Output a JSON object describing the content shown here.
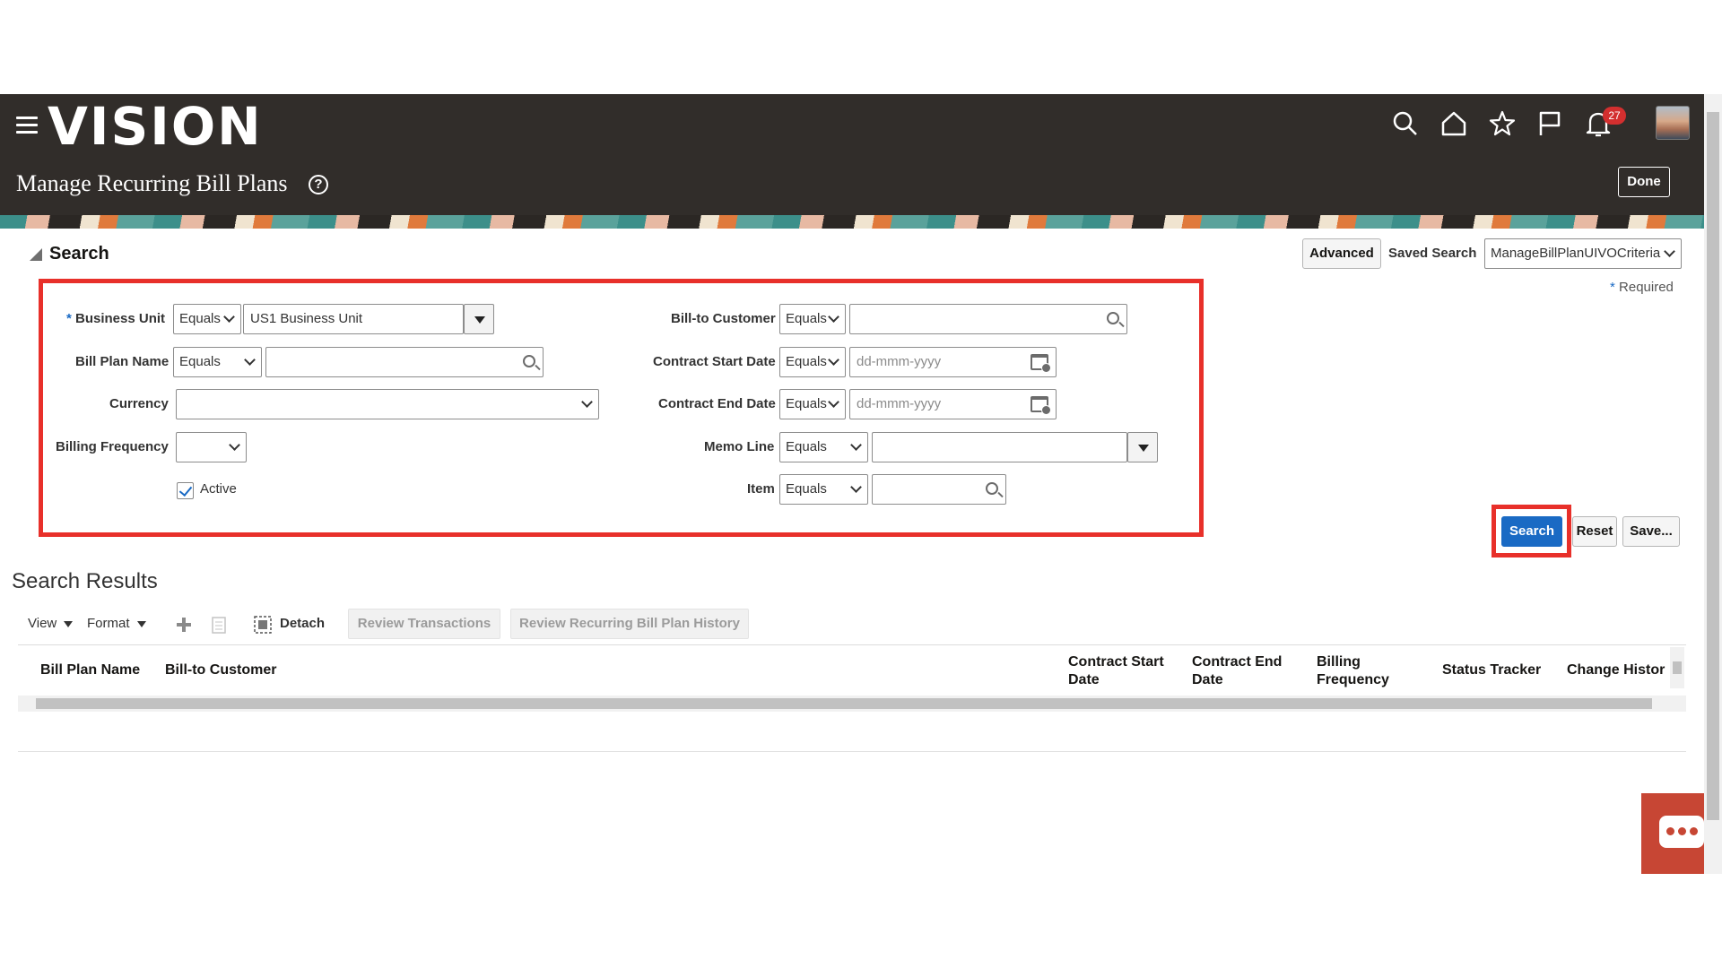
{
  "header": {
    "logo": "VISION",
    "page_title": "Manage Recurring Bill Plans",
    "notification_count": "27",
    "done_label": "Done"
  },
  "search": {
    "title": "Search",
    "advanced_label": "Advanced",
    "saved_search_label": "Saved Search",
    "saved_search_value": "ManageBillPlanUIVOCriteria",
    "required_label": "Required",
    "fields": {
      "business_unit": {
        "label": "Business Unit",
        "operator": "Equals",
        "value": "US1 Business Unit"
      },
      "bill_plan_name": {
        "label": "Bill Plan Name",
        "operator": "Equals",
        "value": ""
      },
      "currency": {
        "label": "Currency",
        "value": ""
      },
      "billing_frequency": {
        "label": "Billing Frequency",
        "value": ""
      },
      "active": {
        "label": "Active",
        "checked": true
      },
      "bill_to_customer": {
        "label": "Bill-to Customer",
        "operator": "Equals",
        "value": ""
      },
      "contract_start_date": {
        "label": "Contract Start Date",
        "operator": "Equals",
        "placeholder": "dd-mmm-yyyy"
      },
      "contract_end_date": {
        "label": "Contract End Date",
        "operator": "Equals",
        "placeholder": "dd-mmm-yyyy"
      },
      "memo_line": {
        "label": "Memo Line",
        "operator": "Equals",
        "value": ""
      },
      "item": {
        "label": "Item",
        "operator": "Equals",
        "value": ""
      }
    },
    "buttons": {
      "search": "Search",
      "reset": "Reset",
      "save": "Save..."
    }
  },
  "results": {
    "title": "Search Results",
    "toolbar": {
      "view": "View",
      "format": "Format",
      "detach": "Detach",
      "review_transactions": "Review Transactions",
      "review_history": "Review Recurring Bill Plan History"
    },
    "columns": {
      "bill_plan_name": "Bill Plan Name",
      "bill_to_customer": "Bill-to Customer",
      "contract_start_1": "Contract Start",
      "contract_start_2": "Date",
      "contract_end_1": "Contract End",
      "contract_end_2": "Date",
      "billing_freq_1": "Billing",
      "billing_freq_2": "Frequency",
      "status_tracker": "Status Tracker",
      "change_history": "Change Histor"
    }
  }
}
